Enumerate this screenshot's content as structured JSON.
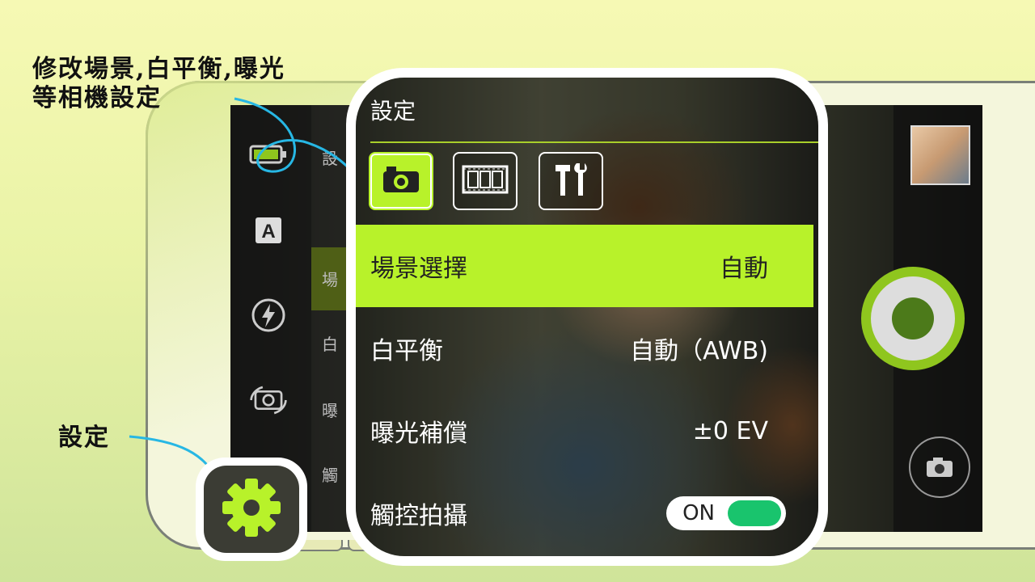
{
  "callouts": {
    "scene_wb_exposure_line1": "修改場景,白平衡,曝光",
    "scene_wb_exposure_line2": "等相機設定",
    "settings": "設定"
  },
  "phone_screen": {
    "mid_panel_peeks": [
      "設",
      "場",
      "白",
      "曝",
      "觸"
    ],
    "left_bar_icons": [
      "battery-icon",
      "auto-mode-icon",
      "flash-icon",
      "switch-camera-icon"
    ],
    "right_bar_icons": [
      "gallery-thumbnail",
      "shutter-button",
      "camera-mode-icon"
    ]
  },
  "settings_panel": {
    "title": "設定",
    "tabs": [
      {
        "name": "camera-tab",
        "icon": "camera-icon",
        "active": true
      },
      {
        "name": "video-tab",
        "icon": "film-icon",
        "active": false
      },
      {
        "name": "tools-tab",
        "icon": "tools-icon",
        "active": false
      }
    ],
    "rows": [
      {
        "label": "場景選擇",
        "value": "自動"
      },
      {
        "label": "白平衡",
        "value": "自動（AWB)"
      },
      {
        "label": "曝光補償",
        "value": "±0 EV"
      },
      {
        "label": "觸控拍攝",
        "value": "ON"
      }
    ]
  },
  "colors": {
    "accent": "#b8f22a",
    "toggle_on": "#19c46d",
    "callout_arrow": "#27b7e4"
  }
}
